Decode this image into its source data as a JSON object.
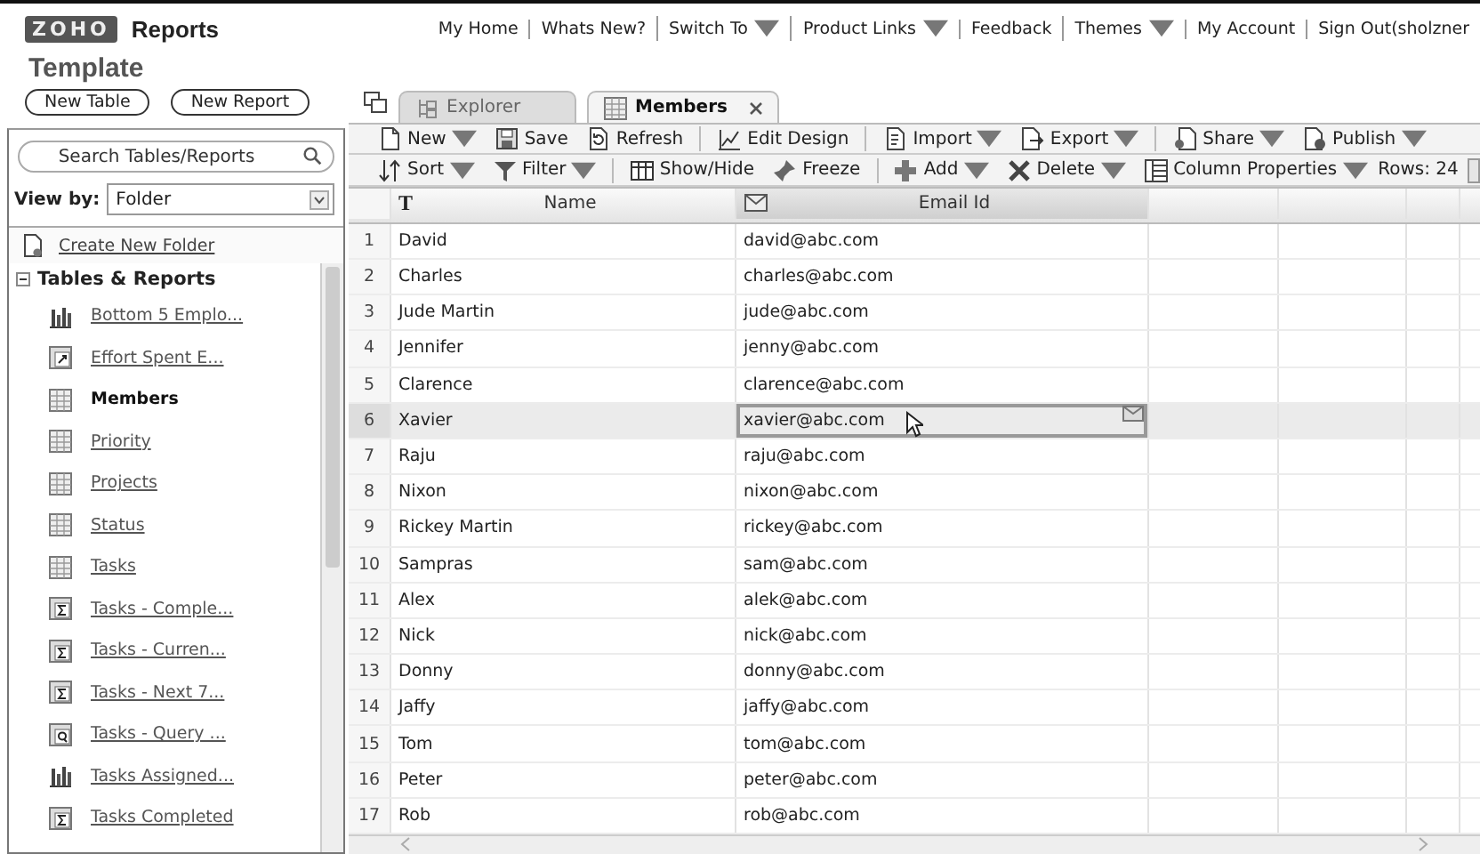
{
  "header": {
    "logo": "ZOHO",
    "product": "Reports",
    "nav": [
      {
        "label": "My Home",
        "dropdown": false
      },
      {
        "label": "Whats New?",
        "dropdown": false
      },
      {
        "label": "Switch To",
        "dropdown": true
      },
      {
        "label": "Product Links",
        "dropdown": true
      },
      {
        "label": "Feedback",
        "dropdown": false
      },
      {
        "label": "Themes",
        "dropdown": true
      },
      {
        "label": "My Account",
        "dropdown": false
      },
      {
        "label": "Sign Out(sholzner",
        "dropdown": false
      }
    ]
  },
  "workspace_title": "Template",
  "sidebar": {
    "buttons": [
      "New Table",
      "New Report"
    ],
    "search": {
      "placeholder": "Search Tables/Reports"
    },
    "view_by": {
      "label": "View by:",
      "value": "Folder"
    },
    "create_folder": "Create New Folder",
    "folder": {
      "label": "Tables & Reports",
      "expanded": true,
      "items": [
        {
          "label": "Bottom 5 Emplo...",
          "kind": "chart",
          "selected": false
        },
        {
          "label": "Effort Spent E...",
          "kind": "pivot",
          "selected": false
        },
        {
          "label": "Members",
          "kind": "table",
          "selected": true
        },
        {
          "label": "Priority",
          "kind": "table",
          "selected": false
        },
        {
          "label": "Projects",
          "kind": "table",
          "selected": false
        },
        {
          "label": "Status",
          "kind": "table",
          "selected": false
        },
        {
          "label": "Tasks",
          "kind": "table",
          "selected": false
        },
        {
          "label": "Tasks - Comple...",
          "kind": "summary",
          "selected": false
        },
        {
          "label": "Tasks - Curren...",
          "kind": "summary",
          "selected": false
        },
        {
          "label": "Tasks - Next 7...",
          "kind": "summary",
          "selected": false
        },
        {
          "label": "Tasks - Query ...",
          "kind": "query",
          "selected": false
        },
        {
          "label": "Tasks Assigned...",
          "kind": "chart",
          "selected": false
        },
        {
          "label": "Tasks Completed",
          "kind": "summary",
          "selected": false
        }
      ]
    }
  },
  "tabs": [
    {
      "label": "Explorer",
      "kind": "explorer",
      "selected": false,
      "closable": false
    },
    {
      "label": "Members",
      "kind": "table",
      "selected": true,
      "closable": true
    }
  ],
  "toolbar": [
    {
      "label": "New",
      "kind": "new",
      "dropdown": true,
      "separator_after": false
    },
    {
      "label": "Save",
      "kind": "save",
      "dropdown": false,
      "separator_after": false
    },
    {
      "label": "Refresh",
      "kind": "refresh",
      "dropdown": false,
      "separator_after": true
    },
    {
      "label": "Edit Design",
      "kind": "design",
      "dropdown": false,
      "separator_after": true
    },
    {
      "label": "Import",
      "kind": "import",
      "dropdown": true,
      "separator_after": false
    },
    {
      "label": "Export",
      "kind": "export",
      "dropdown": true,
      "separator_after": true
    },
    {
      "label": "Share",
      "kind": "share",
      "dropdown": true,
      "separator_after": false
    },
    {
      "label": "Publish",
      "kind": "publish",
      "dropdown": true,
      "separator_after": false
    }
  ],
  "table_toolbar": {
    "tools": [
      {
        "label": "Sort",
        "kind": "sort",
        "dropdown": true,
        "separator_after": false
      },
      {
        "label": "Filter",
        "kind": "filter",
        "dropdown": true,
        "separator_after": true
      },
      {
        "label": "Show/Hide",
        "kind": "columns",
        "dropdown": false,
        "separator_after": false
      },
      {
        "label": "Freeze",
        "kind": "freeze",
        "dropdown": false,
        "separator_after": true
      },
      {
        "label": "Add",
        "kind": "add",
        "dropdown": true,
        "separator_after": false
      },
      {
        "label": "Delete",
        "kind": "delete",
        "dropdown": true,
        "separator_after": false
      },
      {
        "label": "Column Properties",
        "kind": "properties",
        "dropdown": true,
        "separator_after": false
      }
    ],
    "rows_count": "Rows: 24"
  },
  "table": {
    "columns": [
      {
        "label": "Name",
        "kind": "text",
        "type_glyph": "T"
      },
      {
        "label": "Email Id",
        "kind": "email"
      }
    ],
    "rows": [
      {
        "num": "1",
        "name": "David",
        "email": "david@abc.com",
        "selected": false,
        "focused": false
      },
      {
        "num": "2",
        "name": "Charles",
        "email": "charles@abc.com",
        "selected": false,
        "focused": false
      },
      {
        "num": "3",
        "name": "Jude Martin",
        "email": "jude@abc.com",
        "selected": false,
        "focused": false
      },
      {
        "num": "4",
        "name": "Jennifer",
        "email": "jenny@abc.com",
        "selected": false,
        "focused": false
      },
      {
        "num": "5",
        "name": "Clarence",
        "email": "clarence@abc.com",
        "selected": false,
        "focused": false
      },
      {
        "num": "6",
        "name": "Xavier",
        "email": "xavier@abc.com",
        "selected": true,
        "focused": true
      },
      {
        "num": "7",
        "name": "Raju",
        "email": "raju@abc.com",
        "selected": false,
        "focused": false
      },
      {
        "num": "8",
        "name": "Nixon",
        "email": "nixon@abc.com",
        "selected": false,
        "focused": false
      },
      {
        "num": "9",
        "name": "Rickey Martin",
        "email": "rickey@abc.com",
        "selected": false,
        "focused": false
      },
      {
        "num": "10",
        "name": "Sampras",
        "email": "sam@abc.com",
        "selected": false,
        "focused": false
      },
      {
        "num": "11",
        "name": "Alex",
        "email": "alek@abc.com",
        "selected": false,
        "focused": false
      },
      {
        "num": "12",
        "name": "Nick",
        "email": "nick@abc.com",
        "selected": false,
        "focused": false
      },
      {
        "num": "13",
        "name": "Donny",
        "email": "donny@abc.com",
        "selected": false,
        "focused": false
      },
      {
        "num": "14",
        "name": "Jaffy",
        "email": "jaffy@abc.com",
        "selected": false,
        "focused": false
      },
      {
        "num": "15",
        "name": "Tom",
        "email": "tom@abc.com",
        "selected": false,
        "focused": false
      },
      {
        "num": "16",
        "name": "Peter",
        "email": "peter@abc.com",
        "selected": false,
        "focused": false
      },
      {
        "num": "17",
        "name": "Rob",
        "email": "rob@abc.com",
        "selected": false,
        "focused": false
      }
    ]
  }
}
